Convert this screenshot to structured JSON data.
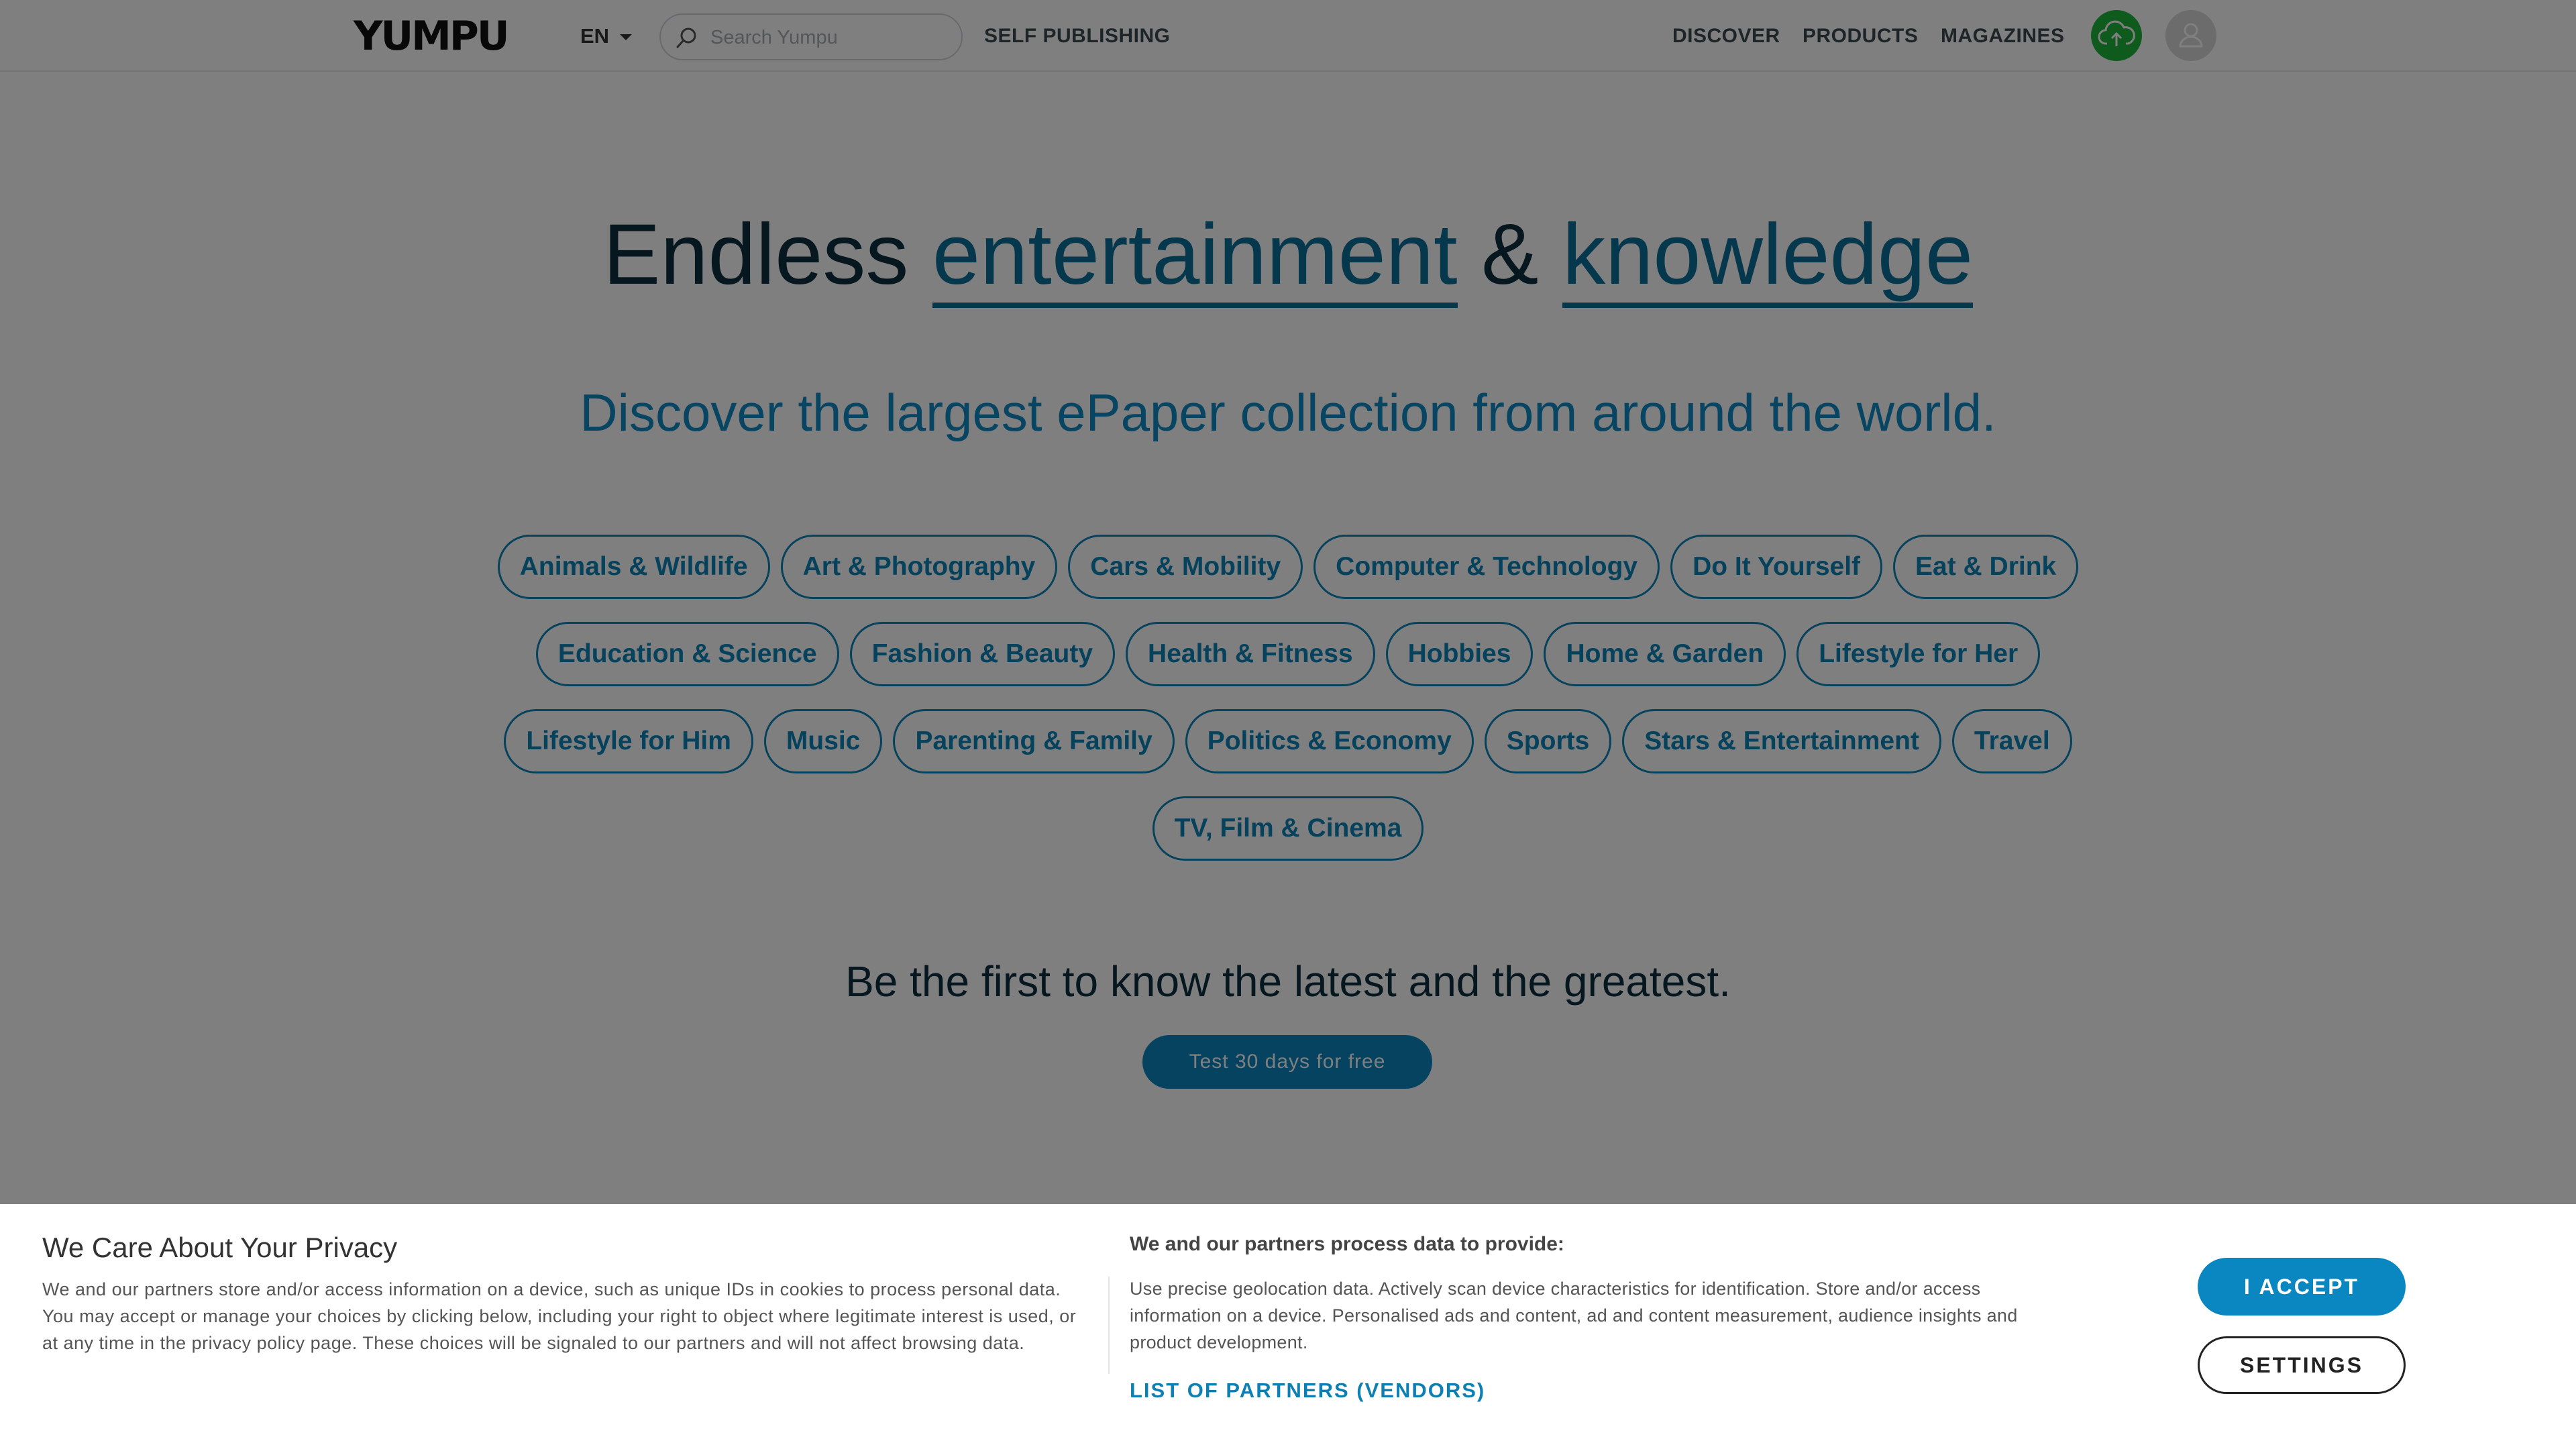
{
  "header": {
    "logo": "YUMPU",
    "language": "EN",
    "search_placeholder": "Search Yumpu",
    "self_publishing": "SELF PUBLISHING",
    "nav": [
      "DISCOVER",
      "PRODUCTS",
      "MAGAZINES"
    ],
    "upload_icon": "cloud-upload-icon",
    "user_icon": "user-icon",
    "upload_color": "#1fb53a"
  },
  "hero": {
    "title_part1": "Endless ",
    "title_link1": "entertainment",
    "title_amp": " & ",
    "title_link2": "knowledge",
    "subtitle": "Discover the largest ePaper collection from around the world."
  },
  "categories": [
    [
      "Animals & Wildlife",
      "Art & Photography",
      "Cars & Mobility",
      "Computer & Technology",
      "Do It Yourself",
      "Eat & Drink"
    ],
    [
      "Education & Science",
      "Fashion & Beauty",
      "Health & Fitness",
      "Hobbies",
      "Home & Garden",
      "Lifestyle for Her"
    ],
    [
      "Lifestyle for Him",
      "Music",
      "Parenting & Family",
      "Politics & Economy",
      "Sports",
      "Stars & Entertainment",
      "Travel"
    ],
    [
      "TV, Film & Cinema"
    ]
  ],
  "promo": {
    "tagline": "Be the first to know the latest and the greatest.",
    "trial_button": "Test 30 days for free"
  },
  "privacy": {
    "title": "We Care About Your Privacy",
    "body": "We and our partners store and/or access information on a device, such as unique IDs in cookies to process personal data. You may accept or manage your choices by clicking below, including your right to object where legitimate interest is used, or at any time in the privacy policy page. These choices will be signaled to our partners and will not affect browsing data.",
    "purposes_title": "We and our partners process data to provide:",
    "purposes_body": "Use precise geolocation data. Actively scan device characteristics for identification. Store and/or access information on a device. Personalised ads and content, ad and content measurement, audience insights and product development.",
    "partners_link": "LIST OF PARTNERS (VENDORS)",
    "accept_button": "I ACCEPT",
    "settings_button": "SETTINGS"
  },
  "colors": {
    "accent": "#0e84bb",
    "dark_text": "#0c2e3f",
    "overlay": "rgba(0,0,0,0.5)"
  }
}
